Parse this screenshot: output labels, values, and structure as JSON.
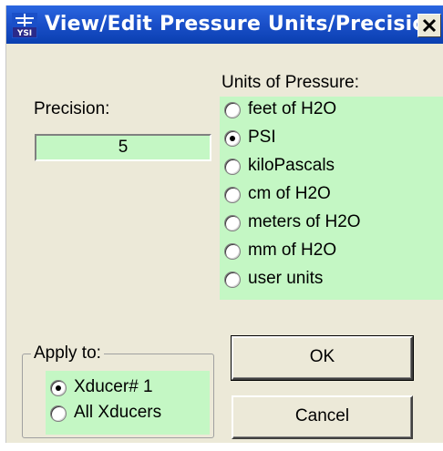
{
  "window": {
    "title": "View/Edit Pressure Units/Precision",
    "icon": "ysi-logo-icon",
    "close_icon": "close-icon"
  },
  "precision": {
    "label": "Precision:",
    "value": "5"
  },
  "units": {
    "label": "Units of Pressure:",
    "options": [
      {
        "label": "feet of H2O",
        "checked": false
      },
      {
        "label": "PSI",
        "checked": true
      },
      {
        "label": "kiloPascals",
        "checked": false
      },
      {
        "label": "cm of H2O",
        "checked": false
      },
      {
        "label": "meters of H2O",
        "checked": false
      },
      {
        "label": "mm of H2O",
        "checked": false
      },
      {
        "label": "user units",
        "checked": false
      }
    ]
  },
  "apply_to": {
    "label": "Apply to:",
    "options": [
      {
        "label": "Xducer# 1",
        "checked": true
      },
      {
        "label": "All Xducers",
        "checked": false
      }
    ]
  },
  "buttons": {
    "ok": "OK",
    "cancel": "Cancel"
  },
  "colors": {
    "titlebar": "#1a4fc8",
    "panel_green": "#c4f7c4",
    "dialog_bg": "#ece9d8"
  }
}
